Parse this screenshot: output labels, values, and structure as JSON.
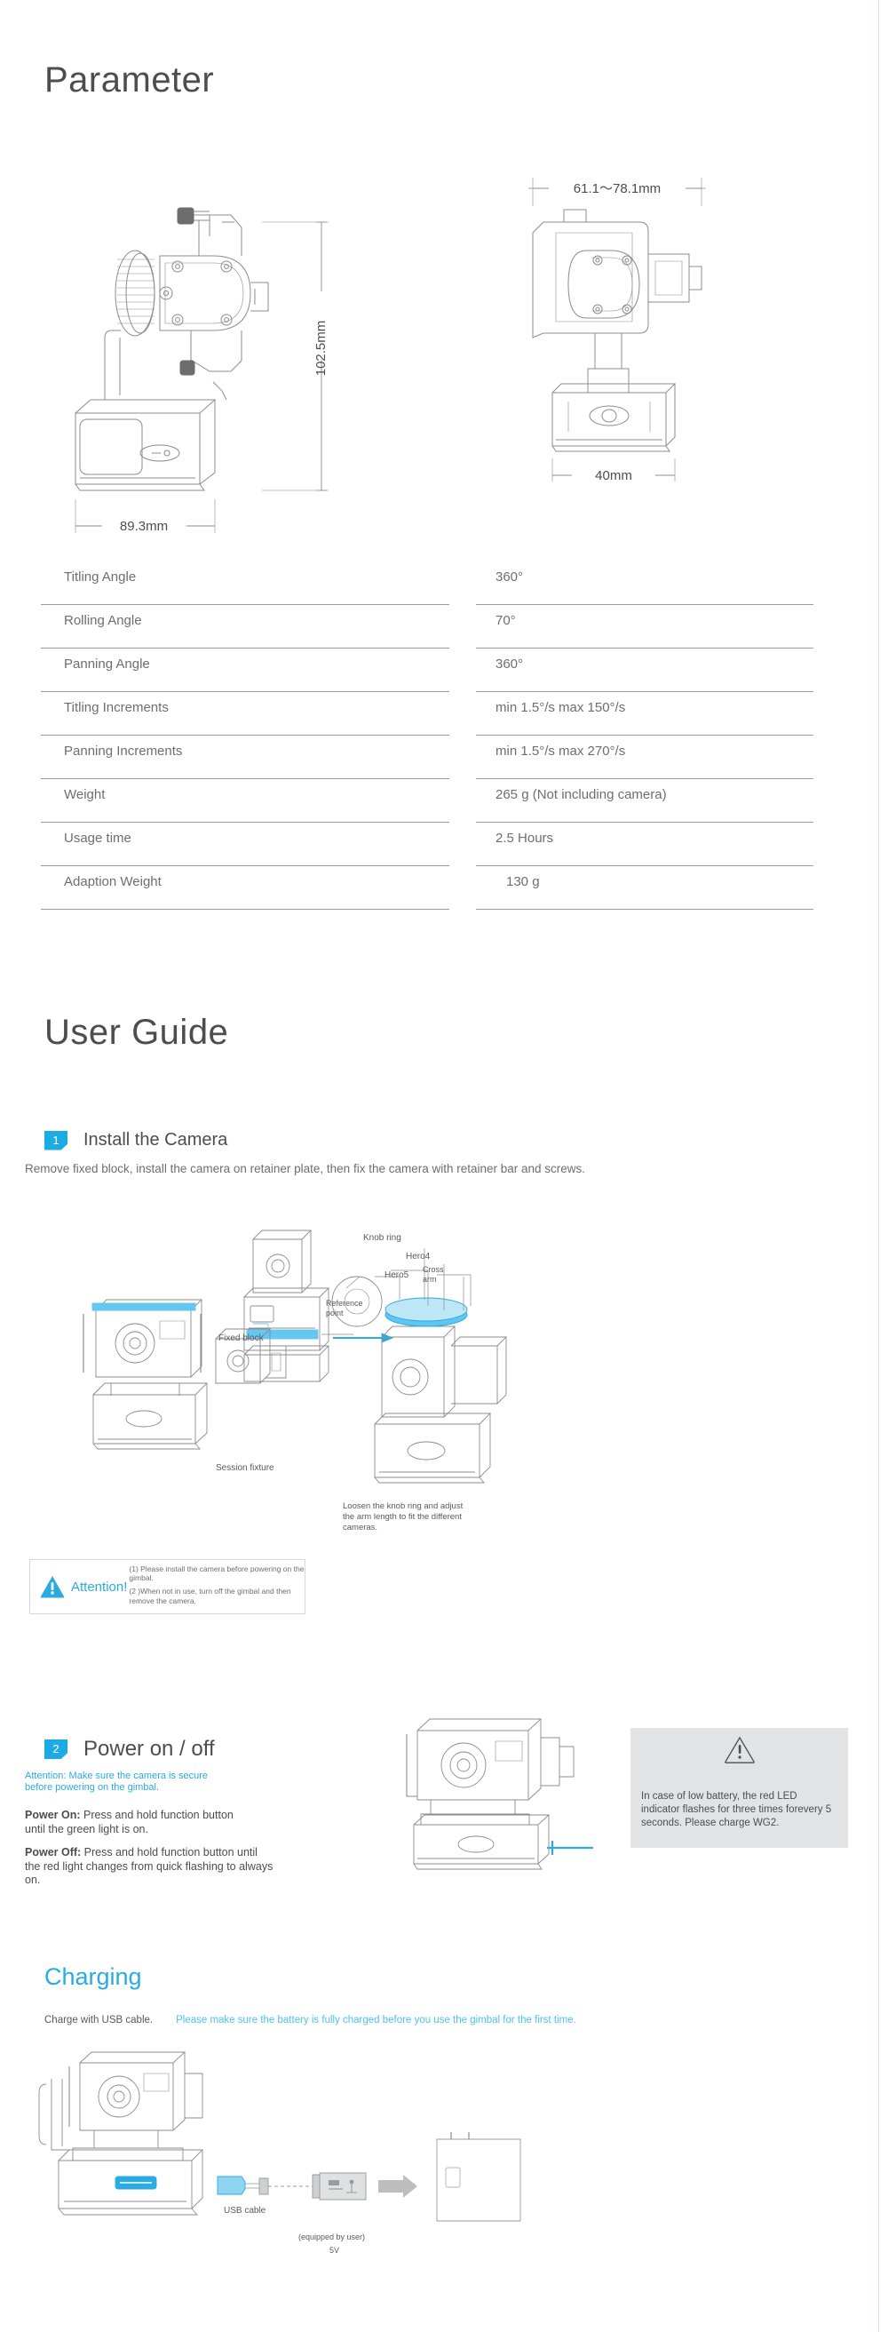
{
  "sections": {
    "parameter_title": "Parameter",
    "userguide_title": "User Guide",
    "charging_title": "Charging"
  },
  "drawings": {
    "side_view": {
      "height_dim": "102.5mm",
      "width_dim": "89.3mm"
    },
    "front_view": {
      "width_dim": "61.1～78.1mm",
      "base_dim": "40mm"
    }
  },
  "spec_table": {
    "rows": [
      {
        "name": "Titling Angle",
        "value": "360°"
      },
      {
        "name": "Rolling Angle",
        "value": "70°"
      },
      {
        "name": "Panning Angle",
        "value": "360°"
      },
      {
        "name": "Titling Increments",
        "value": "min 1.5°/s max 150°/s"
      },
      {
        "name": "Panning Increments",
        "value": "min 1.5°/s max 270°/s"
      },
      {
        "name": "Weight",
        "value": "265 g  (Not including camera)"
      },
      {
        "name": "Usage time",
        "value": "2.5 Hours"
      },
      {
        "name": "Adaption Weight",
        "value": "130 g"
      }
    ]
  },
  "step1": {
    "number": "1",
    "title": "Install the Camera",
    "description": "Remove fixed  block, install the camera on retainer plate, then fix the  camera with retainer bar and screws.",
    "callouts": {
      "fixed_block": "Fixed  block",
      "session_fixture": "Session fixture",
      "knob_ring": "Knob ring",
      "hero4": "Hero4",
      "hero5": "Hero5",
      "cross_arm": "Cross\narm",
      "reference_point": "Reference\npoint",
      "loosen_note": "Loosen the knob ring and adjust\nthe arm length to fit the different\ncameras."
    },
    "attention": {
      "label": "Attention!",
      "items": [
        "(1) Please install the camera before powering on the gimbal.",
        "(2 )When not in use, turn off the gimbal and then remove the camera."
      ]
    }
  },
  "step2": {
    "number": "2",
    "title": "Power on / off",
    "attention": "Attention: Make sure the camera is secure before powering on the gimbal.",
    "power_on_label": "Power On:",
    "power_on_text": " Press and hold function button until the green light is on.",
    "power_off_label": "Power Off:",
    "power_off_text": " Press and hold function button until the red light changes from quick flashing to always on.",
    "low_battery_note": "In case of low battery, the red LED indicator flashes for three times forevery 5 seconds. Please charge WG2."
  },
  "charging": {
    "line_left": "Charge with USB cable.",
    "line_right": "Please make sure the battery is fully charged before you use the gimbal for the first time.",
    "usb_cable_label": "USB cable",
    "adapter_note": "(equipped by user)",
    "adapter_voltage": "5V"
  },
  "colors": {
    "accent_blue": "#29abe2",
    "light_blue": "#4fc0ef",
    "badge_blue": "#1cabe3",
    "text_gray": "#58595b",
    "line_gray": "#9c9c9c"
  }
}
